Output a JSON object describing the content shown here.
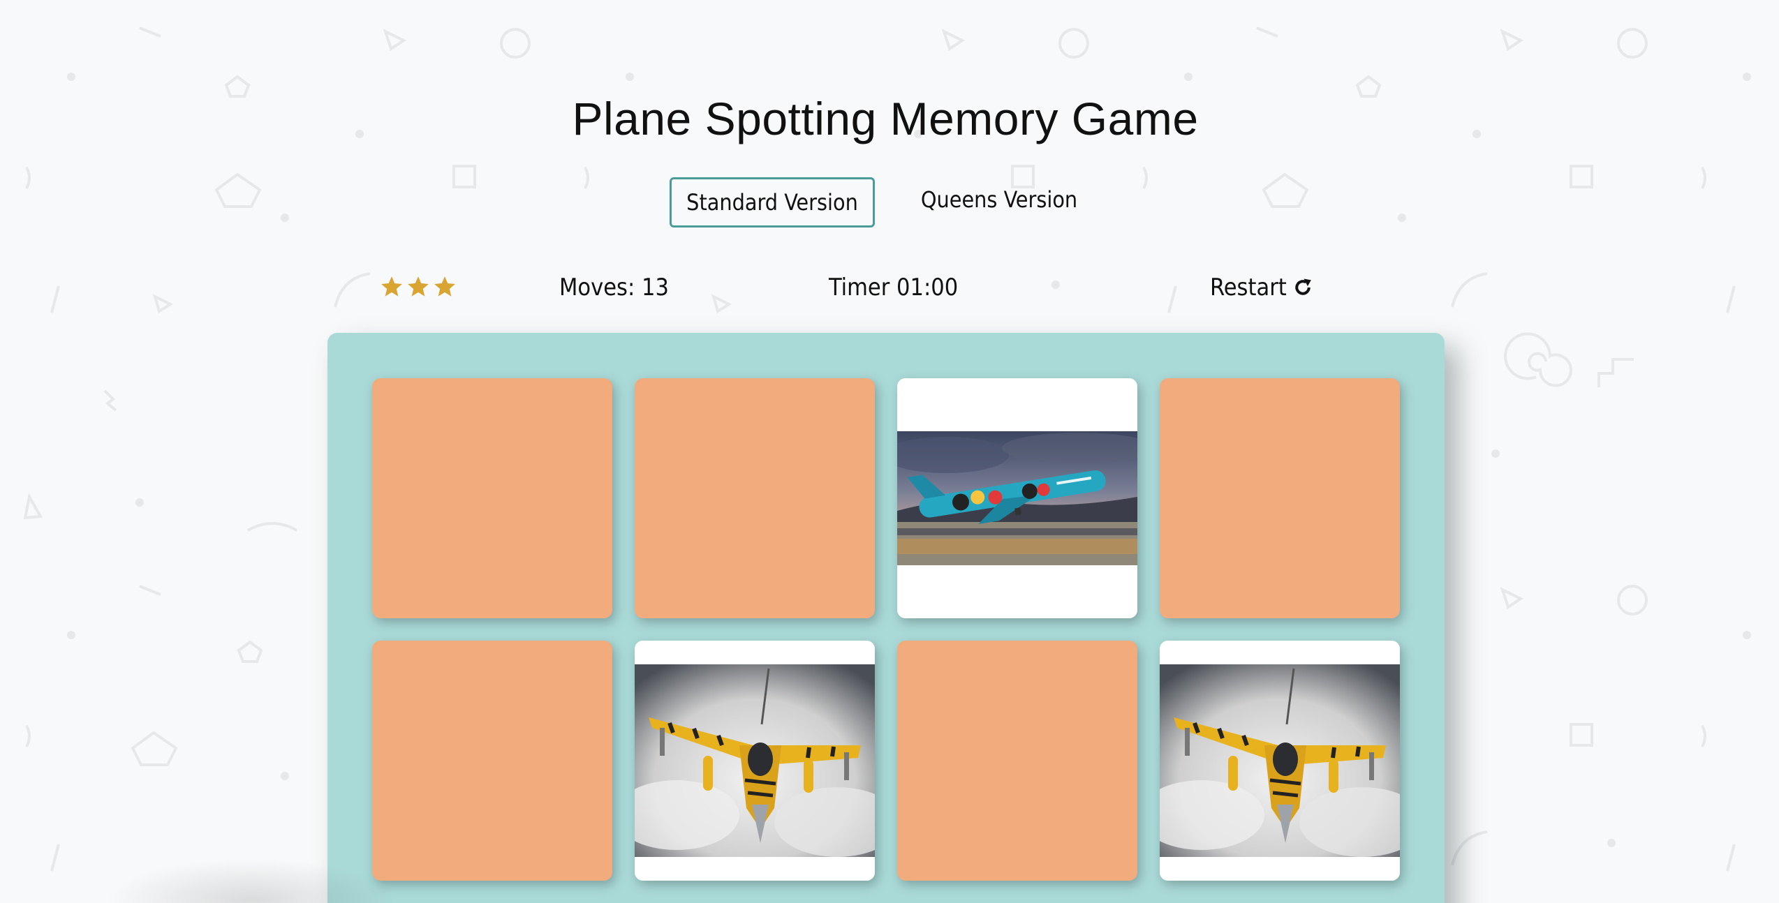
{
  "title": "Plane Spotting Memory Game",
  "versions": [
    {
      "label": "Standard Version",
      "active": true
    },
    {
      "label": "Queens Version",
      "active": false
    }
  ],
  "score_panel": {
    "stars": 3,
    "star_color": "#d9a431",
    "moves_label": "Moves: 13",
    "timer_label": "Timer 01:00",
    "restart_label": "Restart",
    "restart_icon": "refresh-icon"
  },
  "colors": {
    "deck": "#aadad8",
    "card_back": "#f2ab7d",
    "active_outline": "#4b9c98",
    "background": "#f8f9fa"
  },
  "cards": [
    {
      "state": "hidden"
    },
    {
      "state": "hidden"
    },
    {
      "state": "open",
      "image": "airliner-photo"
    },
    {
      "state": "hidden"
    },
    {
      "state": "hidden"
    },
    {
      "state": "open",
      "image": "tiger-jet-photo"
    },
    {
      "state": "hidden"
    },
    {
      "state": "open",
      "image": "tiger-jet-photo"
    }
  ]
}
